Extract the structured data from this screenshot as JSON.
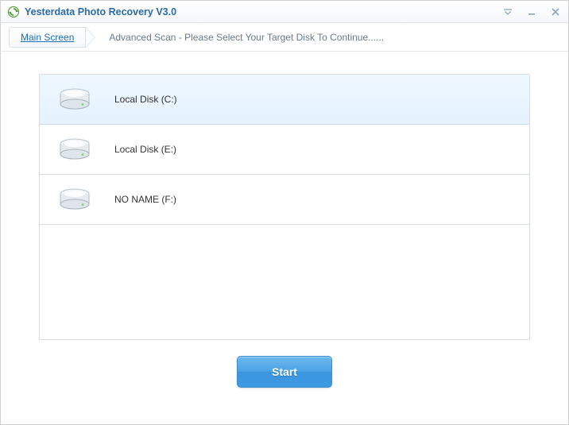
{
  "window": {
    "title": "Yesterdata Photo Recovery V3.0"
  },
  "breadcrumb": {
    "main": "Main Screen",
    "instruction": "Advanced Scan - Please Select Your Target Disk To Continue......"
  },
  "disks": [
    {
      "label": "Local Disk (C:)",
      "selected": true
    },
    {
      "label": "Local Disk (E:)",
      "selected": false
    },
    {
      "label": "NO NAME (F:)",
      "selected": false
    }
  ],
  "actions": {
    "start": "Start"
  },
  "colors": {
    "accent": "#3a95de",
    "title": "#2a6ba8",
    "selected_row_bg": "#e8f4fd"
  }
}
